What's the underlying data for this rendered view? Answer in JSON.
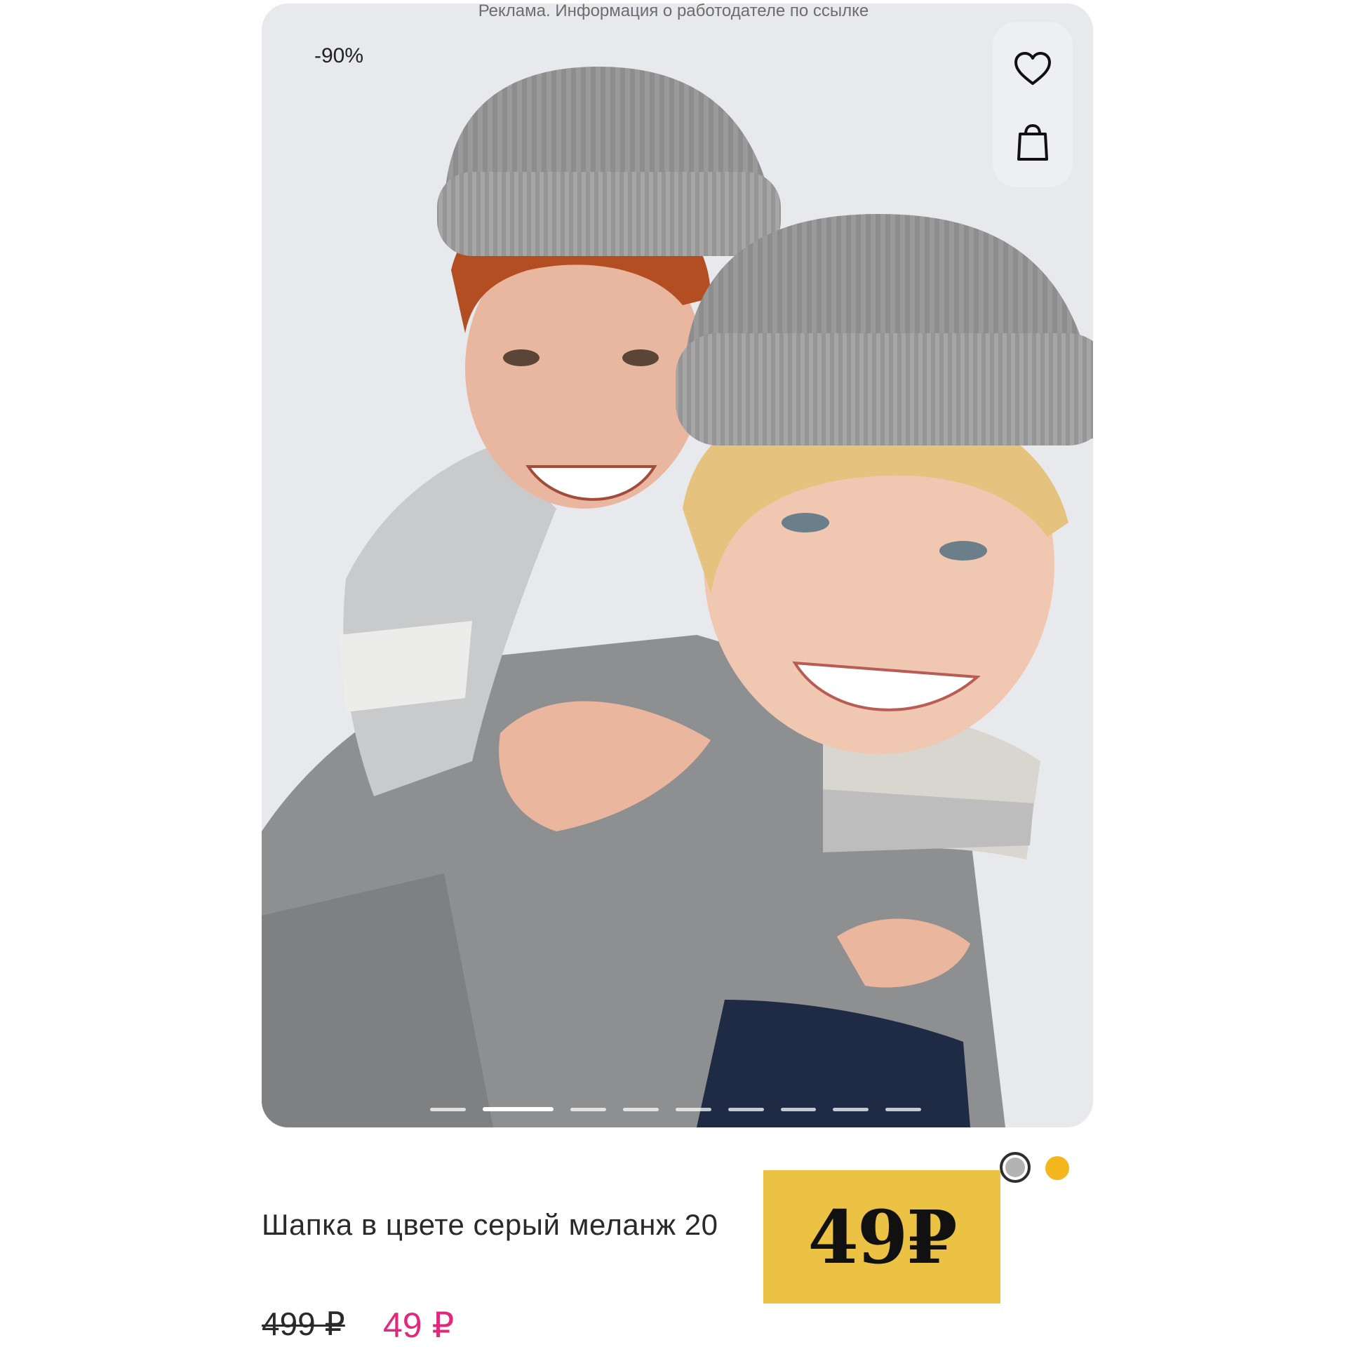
{
  "ad_note": "Реклама. Информация о работодателе по ссылке",
  "product": {
    "discount_badge": "-90%",
    "title": "Шапка в цвете серый меланж 20",
    "old_price": "499 ₽",
    "new_price": "49 ₽",
    "sticker_price": "49₽",
    "image_count": 9,
    "active_image_index": 1
  },
  "actions": {
    "favorite_icon": "heart-icon",
    "cart_icon": "shopping-bag-icon"
  },
  "colors": {
    "options": [
      "#b3b3b3",
      "#f4b61c"
    ],
    "selected": "#b3b3b3",
    "price_accent": "#e0287d",
    "sticker_bg": "#ecc244"
  }
}
